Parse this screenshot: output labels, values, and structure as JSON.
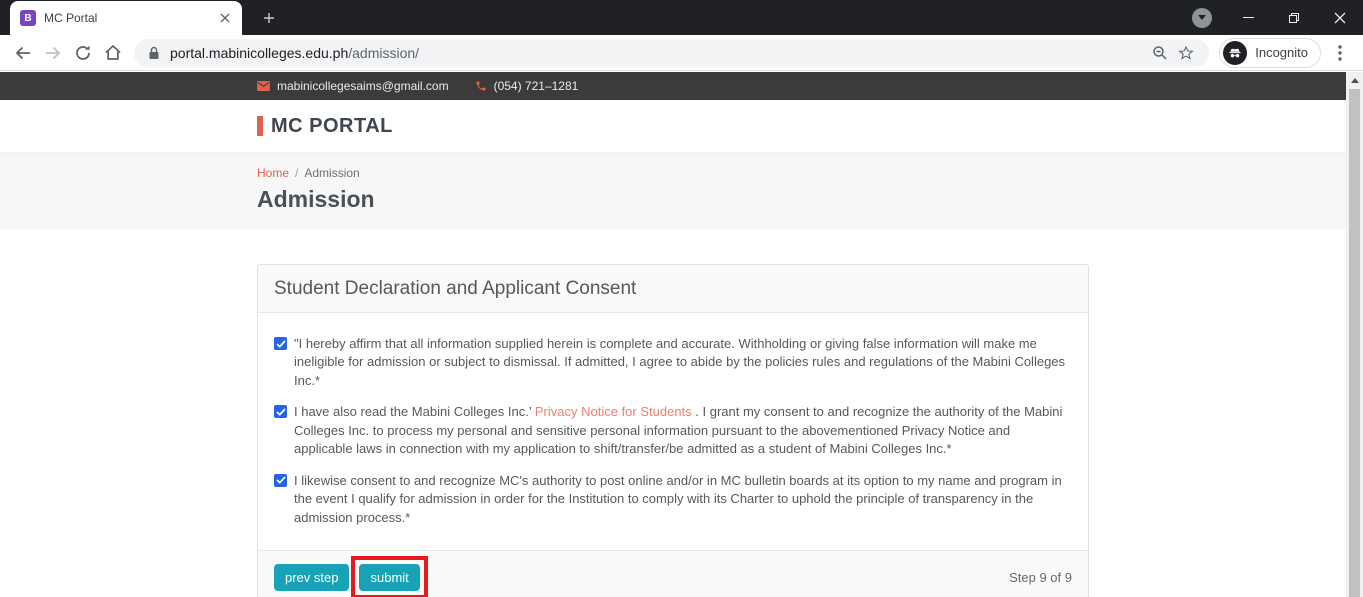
{
  "colors": {
    "accent": "#e4604e",
    "link": "#f0806f",
    "teal": "#17a2b8",
    "annotation": "#e8191f",
    "checkbox": "#2563eb"
  },
  "browser": {
    "tab_title": "MC Portal",
    "favicon_letter": "B",
    "url_domain": "portal.mabinicolleges.edu.ph",
    "url_path": "/admission/",
    "incognito_label": "Incognito"
  },
  "topbar": {
    "email": "mabinicollegesaims@gmail.com",
    "phone": "(054) 721–1281"
  },
  "header": {
    "logo": "MC PORTAL"
  },
  "breadcrumb": {
    "home": "Home",
    "separator": "/",
    "current": "Admission"
  },
  "page_title": "Admission",
  "consent": {
    "title": "Student Declaration and Applicant Consent",
    "items": [
      {
        "checked": true,
        "text": "\"I hereby affirm that all information supplied herein is complete and accurate. Withholding or giving false information will make me ineligible for admission or subject to dismissal. If admitted, I agree to abide by the policies rules and regulations of the Mabini Colleges Inc.*"
      },
      {
        "checked": true,
        "pre": "I have also read the Mabini Colleges Inc.’ ",
        "link": "Privacy Notice for Students",
        "post": " . I grant my consent to and recognize the authority of the Mabini Colleges Inc. to process my personal and sensitive personal information pursuant to the abovementioned Privacy Notice and applicable laws in connection with my application to shift/transfer/be admitted as a student of Mabini Colleges Inc.*"
      },
      {
        "checked": true,
        "text": "I likewise consent to and recognize MC's authority to post online and/or in MC bulletin boards at its option to my name and program in the event I qualify for admission in order for the Institution to comply with its Charter to uphold the principle of transparency in the admission process.*"
      }
    ],
    "prev_label": "prev step",
    "submit_label": "submit",
    "step_text": "Step 9 of 9"
  }
}
